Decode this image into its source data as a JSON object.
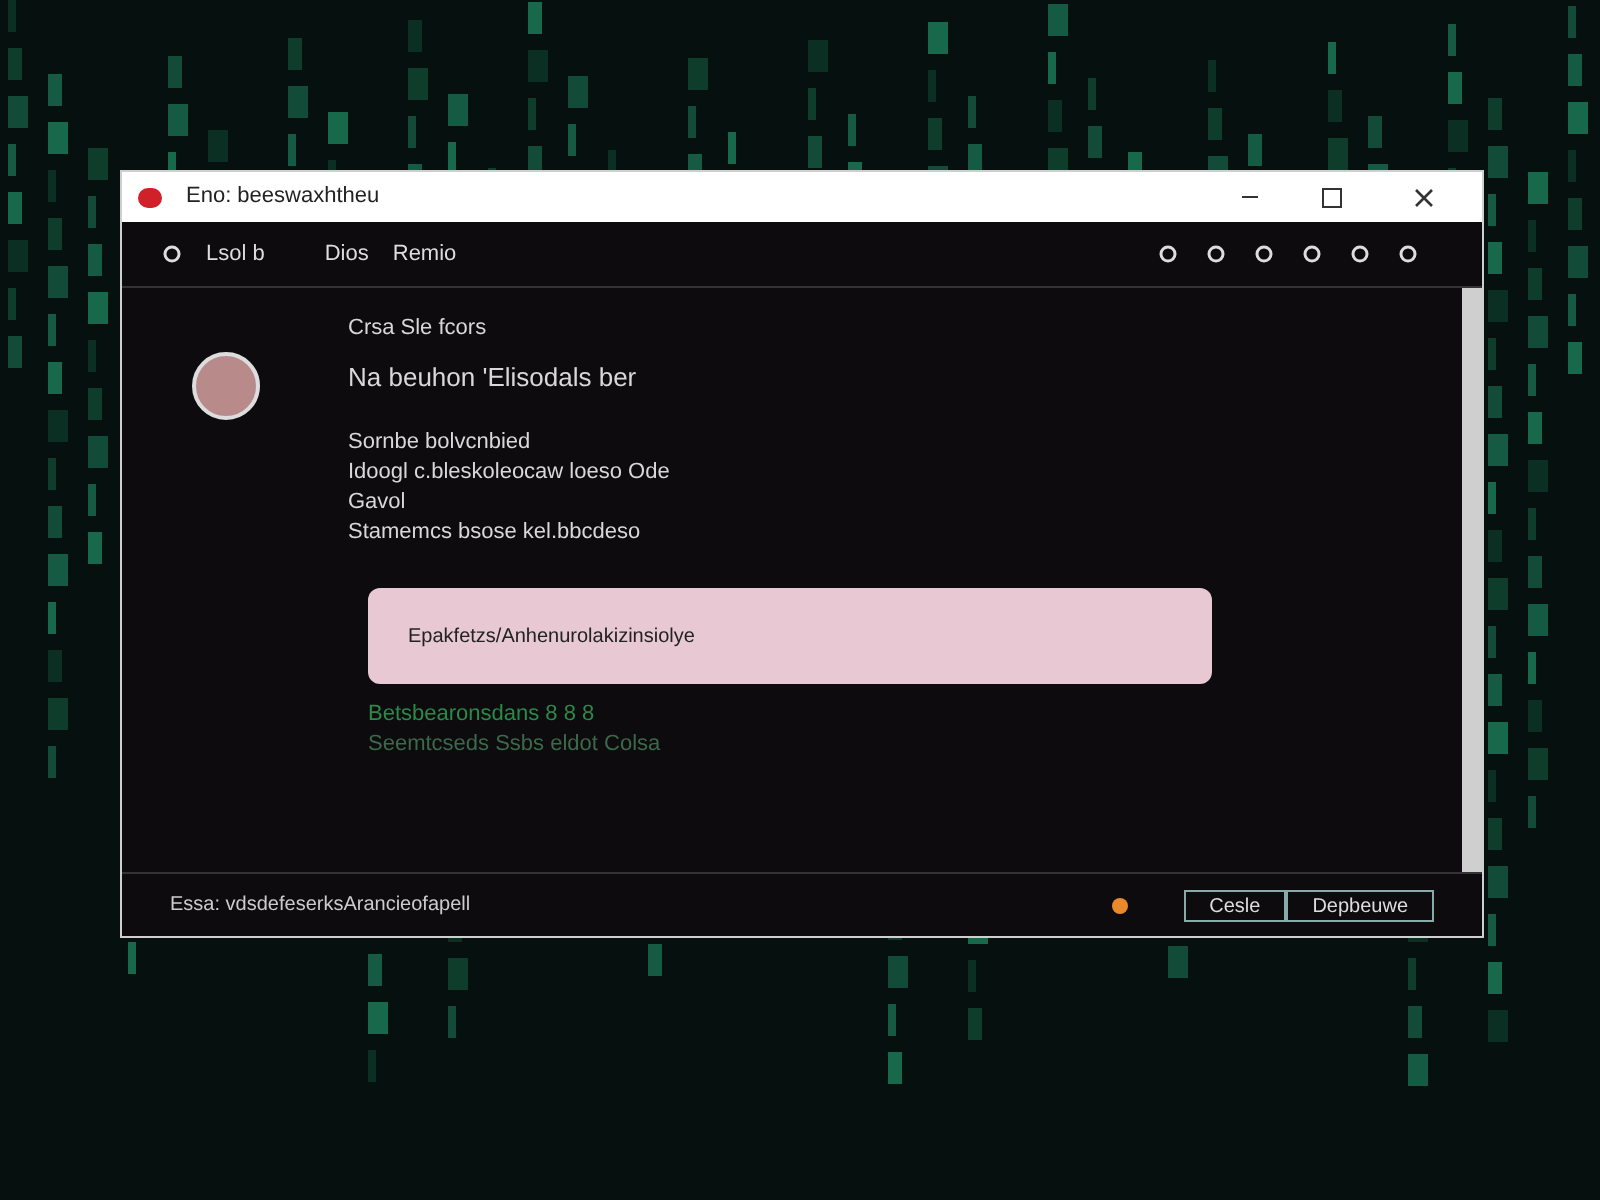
{
  "window": {
    "title": "Eno: beeswaxhtheu"
  },
  "toolbar": {
    "left": [
      "Lsol b"
    ],
    "middle": [
      "Dios",
      "Remio"
    ]
  },
  "message": {
    "header": "Crsa   Sle fcors",
    "subject": "Na beuhon 'Elisodals ber",
    "body": [
      "Sornbe bolvcnbied",
      "Idoogl c.bleskoleocaw loeso Ode",
      "Gavol",
      "Stamemcs bsose kel.bbcdeso"
    ],
    "notice": "Epakfetzs/Anhenurolakizinsiolye",
    "green_lines": [
      "Betsbearonsdans 8 8 8",
      "Seemtcseds Ssbs eldot Colsa"
    ]
  },
  "status_bar": {
    "text": "Essa: vdsdefeserksArancieofapell",
    "buttons": [
      "Cesle",
      "Depbeuwe"
    ]
  }
}
